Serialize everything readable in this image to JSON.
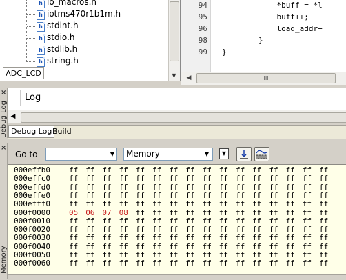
{
  "workspace": {
    "files": [
      "io_macros.h",
      "iotms470r1b1m.h",
      "stdint.h",
      "stdio.h",
      "stdlib.h",
      "string.h"
    ],
    "tab_label": "ADC_LCD",
    "file_icon_glyph": "h"
  },
  "editor": {
    "lines": [
      {
        "num": "94",
        "code": "            *buff = *l"
      },
      {
        "num": "95",
        "code": "            buff++;"
      },
      {
        "num": "96",
        "code": "            load_addr+"
      },
      {
        "num": "98",
        "code": "        }"
      },
      {
        "num": "99",
        "code": "}"
      }
    ],
    "scroll_grip": "III"
  },
  "debug_log": {
    "side_label": "Debug Log",
    "column_title": "Log",
    "tabs": [
      "Debug Log",
      "Build"
    ]
  },
  "memory": {
    "side_label": "Memory",
    "goto_label": "Go to",
    "goto_value": "",
    "zone_selected": "Memory",
    "highlight_color": "#c81e1e",
    "rows": [
      {
        "addr": "000effb0",
        "bytes": [
          "ff",
          "ff",
          "ff",
          "ff",
          "ff",
          "ff",
          "ff",
          "ff",
          "ff",
          "ff",
          "ff",
          "ff",
          "ff",
          "ff",
          "ff",
          "ff"
        ]
      },
      {
        "addr": "000effc0",
        "bytes": [
          "ff",
          "ff",
          "ff",
          "ff",
          "ff",
          "ff",
          "ff",
          "ff",
          "ff",
          "ff",
          "ff",
          "ff",
          "ff",
          "ff",
          "ff",
          "ff"
        ]
      },
      {
        "addr": "000effd0",
        "bytes": [
          "ff",
          "ff",
          "ff",
          "ff",
          "ff",
          "ff",
          "ff",
          "ff",
          "ff",
          "ff",
          "ff",
          "ff",
          "ff",
          "ff",
          "ff",
          "ff"
        ]
      },
      {
        "addr": "000effe0",
        "bytes": [
          "ff",
          "ff",
          "ff",
          "ff",
          "ff",
          "ff",
          "ff",
          "ff",
          "ff",
          "ff",
          "ff",
          "ff",
          "ff",
          "ff",
          "ff",
          "ff"
        ]
      },
      {
        "addr": "000efff0",
        "bytes": [
          "ff",
          "ff",
          "ff",
          "ff",
          "ff",
          "ff",
          "ff",
          "ff",
          "ff",
          "ff",
          "ff",
          "ff",
          "ff",
          "ff",
          "ff",
          "ff"
        ]
      },
      {
        "addr": "000f0000",
        "bytes": [
          "05",
          "06",
          "07",
          "08",
          "ff",
          "ff",
          "ff",
          "ff",
          "ff",
          "ff",
          "ff",
          "ff",
          "ff",
          "ff",
          "ff",
          "ff"
        ],
        "changed": [
          0,
          1,
          2,
          3
        ]
      },
      {
        "addr": "000f0010",
        "bytes": [
          "ff",
          "ff",
          "ff",
          "ff",
          "ff",
          "ff",
          "ff",
          "ff",
          "ff",
          "ff",
          "ff",
          "ff",
          "ff",
          "ff",
          "ff",
          "ff"
        ]
      },
      {
        "addr": "000f0020",
        "bytes": [
          "ff",
          "ff",
          "ff",
          "ff",
          "ff",
          "ff",
          "ff",
          "ff",
          "ff",
          "ff",
          "ff",
          "ff",
          "ff",
          "ff",
          "ff",
          "ff"
        ]
      },
      {
        "addr": "000f0030",
        "bytes": [
          "ff",
          "ff",
          "ff",
          "ff",
          "ff",
          "ff",
          "ff",
          "ff",
          "ff",
          "ff",
          "ff",
          "ff",
          "ff",
          "ff",
          "ff",
          "ff"
        ]
      },
      {
        "addr": "000f0040",
        "bytes": [
          "ff",
          "ff",
          "ff",
          "ff",
          "ff",
          "ff",
          "ff",
          "ff",
          "ff",
          "ff",
          "ff",
          "ff",
          "ff",
          "ff",
          "ff",
          "ff"
        ]
      },
      {
        "addr": "000f0050",
        "bytes": [
          "ff",
          "ff",
          "ff",
          "ff",
          "ff",
          "ff",
          "ff",
          "ff",
          "ff",
          "ff",
          "ff",
          "ff",
          "ff",
          "ff",
          "ff",
          "ff"
        ]
      },
      {
        "addr": "000f0060",
        "bytes": [
          "ff",
          "ff",
          "ff",
          "ff",
          "ff",
          "ff",
          "ff",
          "ff",
          "ff",
          "ff",
          "ff",
          "ff",
          "ff",
          "ff",
          "ff",
          "ff"
        ]
      }
    ]
  },
  "icons": {
    "close": "close-icon",
    "tree_file": "header-file-icon",
    "step_into": "step-into-icon",
    "waveform": "waveform-icon"
  }
}
